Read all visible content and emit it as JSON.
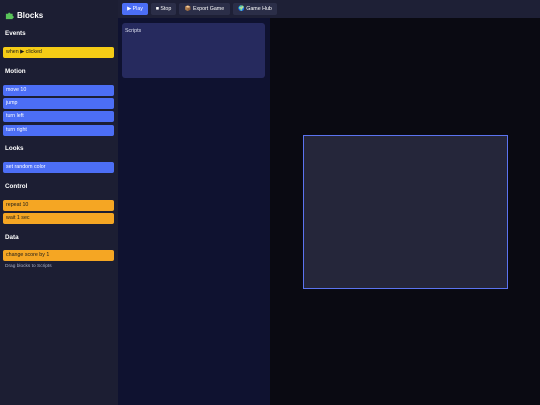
{
  "sidebar": {
    "title": "Blocks",
    "title_icon": "puzzle-piece-icon",
    "hint": "Drag blocks to Scripts",
    "categories": {
      "events": {
        "label": "Events",
        "blocks": [
          "when ▶ clicked"
        ],
        "color": "#f5cc16"
      },
      "motion": {
        "label": "Motion",
        "blocks": [
          "move 10",
          "jump",
          "turn left",
          "turn right"
        ],
        "color": "#4c6ef5"
      },
      "looks": {
        "label": "Looks",
        "blocks": [
          "set random color"
        ],
        "color": "#4c6ef5"
      },
      "control": {
        "label": "Control",
        "blocks": [
          "repeat 10",
          "wait 1 sec"
        ],
        "color": "#f5a623"
      },
      "data": {
        "label": "Data",
        "blocks": [
          "change score by 1"
        ],
        "color": "#f5a623"
      }
    }
  },
  "toolbar": {
    "play_label": "▶ Play",
    "stop_label": "■ Stop",
    "export_label": "Export Game",
    "export_icon": "package-icon",
    "hub_label": "Game Hub",
    "hub_icon": "globe-icon",
    "accent": "#4c6ef5"
  },
  "scripts": {
    "label": "Scripts"
  },
  "stage": {
    "border_color": "#5b73f0"
  }
}
